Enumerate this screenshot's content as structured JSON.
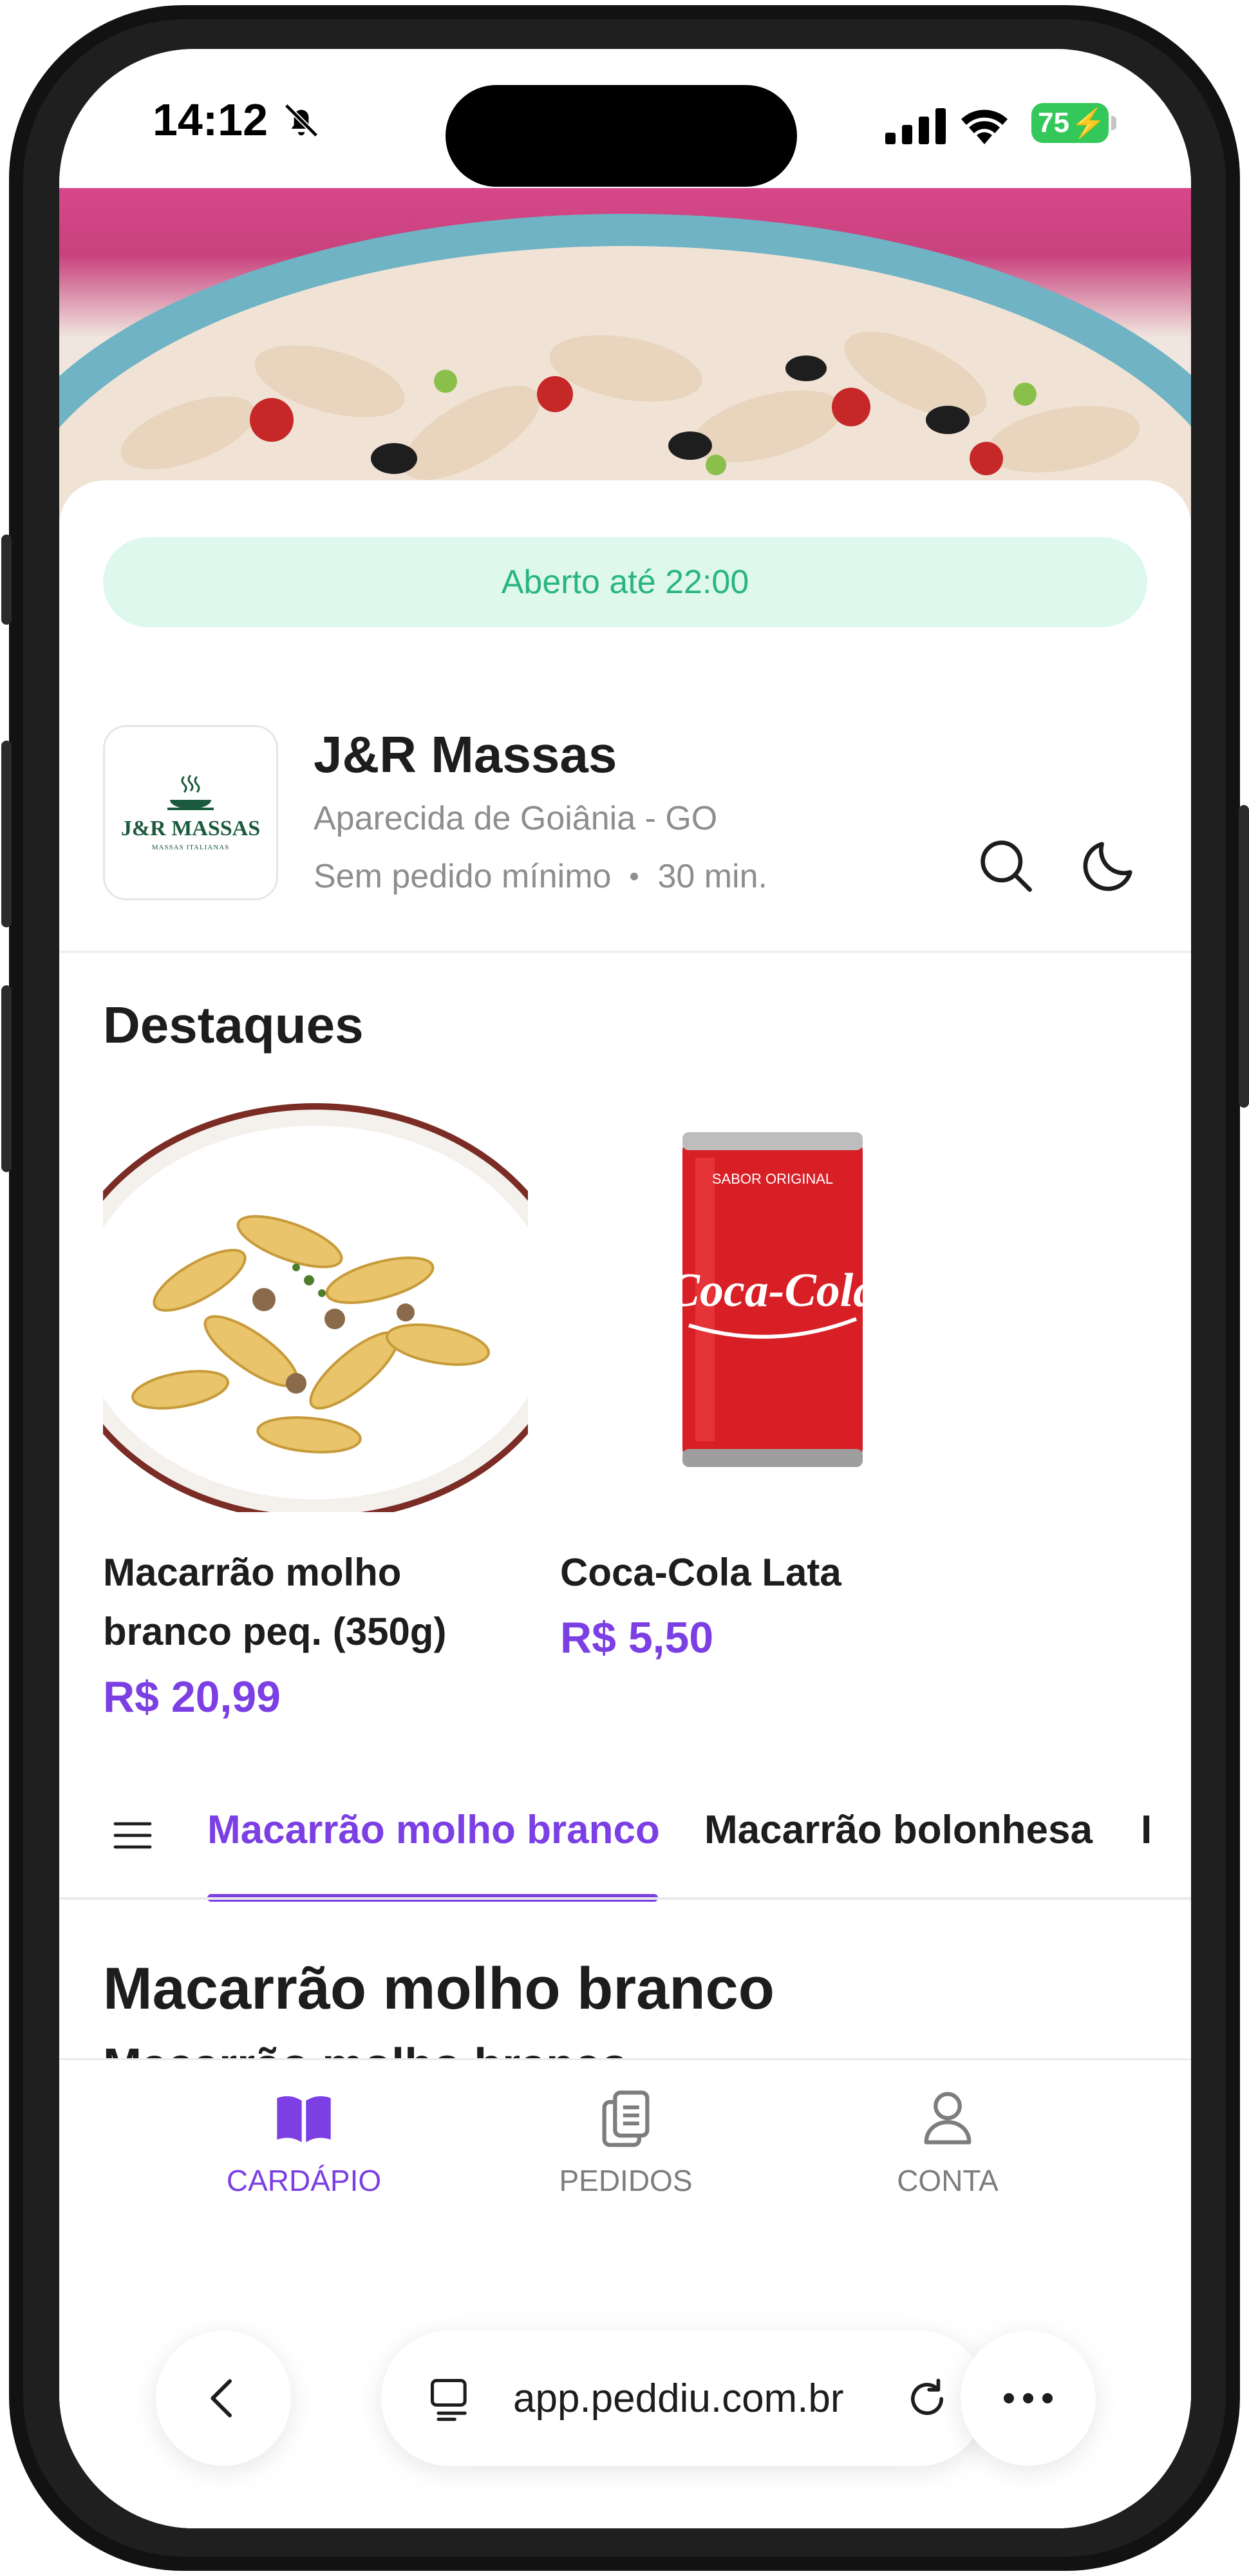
{
  "status_bar": {
    "time": "14:12",
    "battery": "75"
  },
  "store": {
    "open_status": "Aberto até 22:00",
    "name": "J&R Massas",
    "location": "Aparecida de Goiânia - GO",
    "min_order": "Sem pedido mínimo",
    "delivery_time": "30 min.",
    "logo": {
      "name": "J&R MASSAS",
      "subtitle": "MASSAS ITALIANAS"
    }
  },
  "highlights": {
    "title": "Destaques",
    "items": [
      {
        "name_line1": "Macarrão molho",
        "name_line2": "branco peq. (350g)",
        "price": "R$ 20,99"
      },
      {
        "name_line1": "Coca-Cola Lata",
        "name_line2": "",
        "price": "R$ 5,50"
      }
    ],
    "can_text": {
      "top": "SABOR ORIGINAL",
      "brand": "Coca-Cola"
    }
  },
  "category_tabs": {
    "items": [
      {
        "label": "Macarrão molho branco",
        "active": true
      },
      {
        "label": "Macarrão bolonhesa",
        "active": false
      },
      {
        "label": "I",
        "active": false
      }
    ]
  },
  "category_section": {
    "title": "Macarrão molho branco",
    "peek_item": "Macarrão molho branco"
  },
  "bottom_nav": {
    "items": [
      {
        "label": "CARDÁPIO",
        "icon": "book-open-icon",
        "active": true
      },
      {
        "label": "PEDIDOS",
        "icon": "clipboard-icon",
        "active": false
      },
      {
        "label": "CONTA",
        "icon": "user-icon",
        "active": false
      }
    ]
  },
  "browser": {
    "url": "app.peddiu.com.br"
  },
  "colors": {
    "accent": "#7b3fe4",
    "open_green": "#28b67d",
    "open_bg": "#dff8ee"
  }
}
